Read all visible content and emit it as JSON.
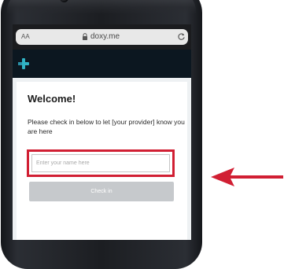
{
  "browser": {
    "text_size_label": "AA",
    "url": "doxy.me",
    "icons": {
      "lock": "lock-icon",
      "reload": "reload-icon"
    }
  },
  "app": {
    "logo_icon": "doxy-plus-logo",
    "accent_color": "#31b3c4"
  },
  "checkin": {
    "title": "Welcome!",
    "instructions": "Please check in below to let [your provider] know you are here",
    "name_placeholder": "Enter your name here",
    "name_value": "",
    "button_label": "Check in",
    "highlight_color": "#d11f33"
  },
  "annotation": {
    "arrow_color": "#d11f33",
    "arrow_icon": "left-arrow"
  }
}
